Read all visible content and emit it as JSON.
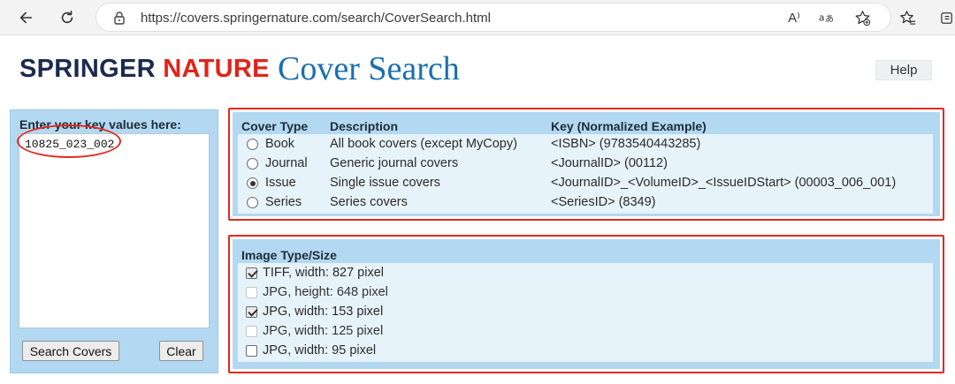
{
  "browser": {
    "url": "https://covers.springernature.com/search/CoverSearch.html",
    "read_aloud_icon": "A⁾"
  },
  "header": {
    "logo_springer": "SPRINGER",
    "logo_nature": "NATURE",
    "title": "Cover Search",
    "help_label": "Help"
  },
  "key_panel": {
    "label": "Enter your key values here:",
    "value": "10825_023_002",
    "search_label": "Search Covers",
    "clear_label": "Clear"
  },
  "cover_type": {
    "headers": {
      "type": "Cover Type",
      "description": "Description",
      "key": "Key (Normalized Example)"
    },
    "rows": [
      {
        "type": "Book",
        "description": "All book covers (except MyCopy)",
        "key": "<ISBN> (9783540443285)",
        "selected": false
      },
      {
        "type": "Journal",
        "description": "Generic journal covers",
        "key": "<JournalID> (00112)",
        "selected": false
      },
      {
        "type": "Issue",
        "description": "Single issue covers",
        "key": "<JournalID>_<VolumeID>_<IssueIDStart> (00003_006_001)",
        "selected": true
      },
      {
        "type": "Series",
        "description": "Series covers",
        "key": "<SeriesID> (8349)",
        "selected": false
      }
    ]
  },
  "image_type": {
    "header": "Image Type/Size",
    "options": [
      {
        "label": "TIFF, width: 827 pixel",
        "checked": true,
        "disabled": false
      },
      {
        "label": "JPG, height: 648 pixel",
        "checked": false,
        "disabled": true
      },
      {
        "label": "JPG, width: 153 pixel",
        "checked": true,
        "disabled": false
      },
      {
        "label": "JPG, width: 125 pixel",
        "checked": false,
        "disabled": true
      },
      {
        "label": "JPG, width: 95 pixel",
        "checked": false,
        "disabled": false
      }
    ]
  },
  "colors": {
    "panel_blue": "#b3d9f2",
    "highlight_red": "#e22a1f",
    "title_blue": "#1a6fb0",
    "brand_navy": "#1b2a4e",
    "brand_red": "#e2231a"
  }
}
